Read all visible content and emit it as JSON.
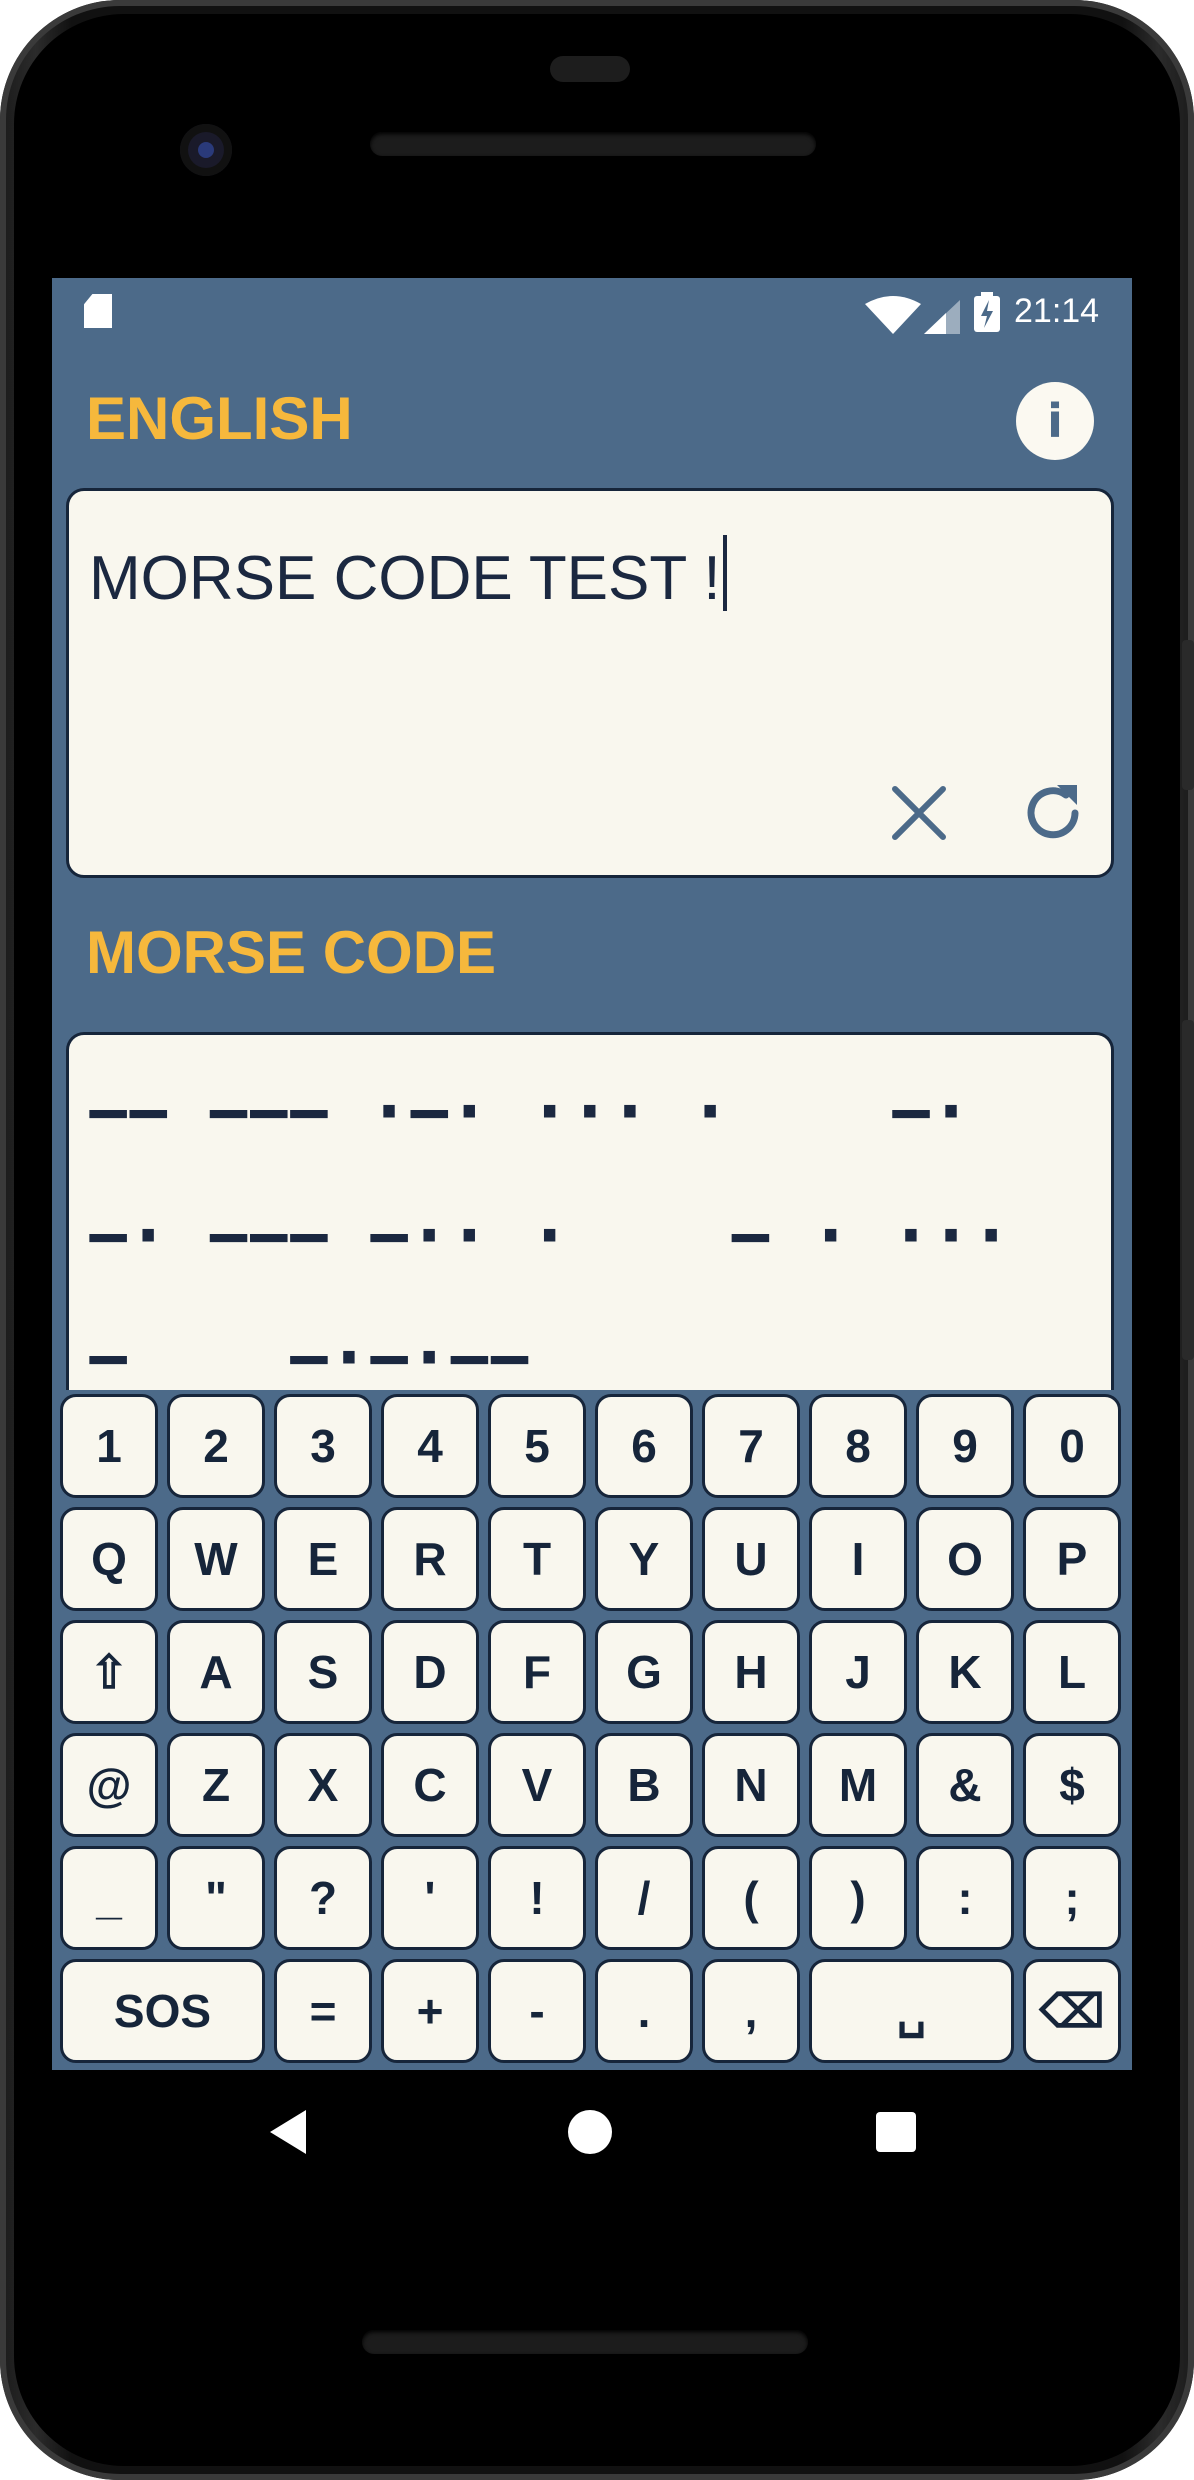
{
  "status_bar": {
    "time": "21:14",
    "icons": [
      "sd-card-icon",
      "wifi-icon",
      "cell-signal-icon",
      "battery-charging-icon"
    ]
  },
  "english": {
    "title": "ENGLISH",
    "info_icon": "i",
    "input_value": "MORSE CODE TEST !",
    "clear_icon": "close-icon",
    "refresh_icon": "refresh-icon"
  },
  "morse": {
    "title": "MORSE CODE",
    "lines": [
      "−− −−− ·−· ··· ·    −·",
      "−· −−− −·· ·    − · ···",
      "−    −·−·−−"
    ]
  },
  "keyboard": {
    "rows": [
      [
        "1",
        "2",
        "3",
        "4",
        "5",
        "6",
        "7",
        "8",
        "9",
        "0"
      ],
      [
        "Q",
        "W",
        "E",
        "R",
        "T",
        "Y",
        "U",
        "I",
        "O",
        "P"
      ],
      [
        "⇧",
        "A",
        "S",
        "D",
        "F",
        "G",
        "H",
        "J",
        "K",
        "L"
      ],
      [
        "@",
        "Z",
        "X",
        "C",
        "V",
        "B",
        "N",
        "M",
        "&",
        "$"
      ],
      [
        "_",
        "\"",
        "?",
        "'",
        "!",
        "/",
        "(",
        ")",
        ":",
        ";"
      ]
    ],
    "bottom_row": [
      "SOS",
      "=",
      "+",
      "-",
      ".",
      ",",
      "␣",
      "⌫"
    ]
  },
  "colors": {
    "background": "#4c6a89",
    "accent": "#f6b83c",
    "panel": "#f9f7ee",
    "text": "#1b2840"
  }
}
